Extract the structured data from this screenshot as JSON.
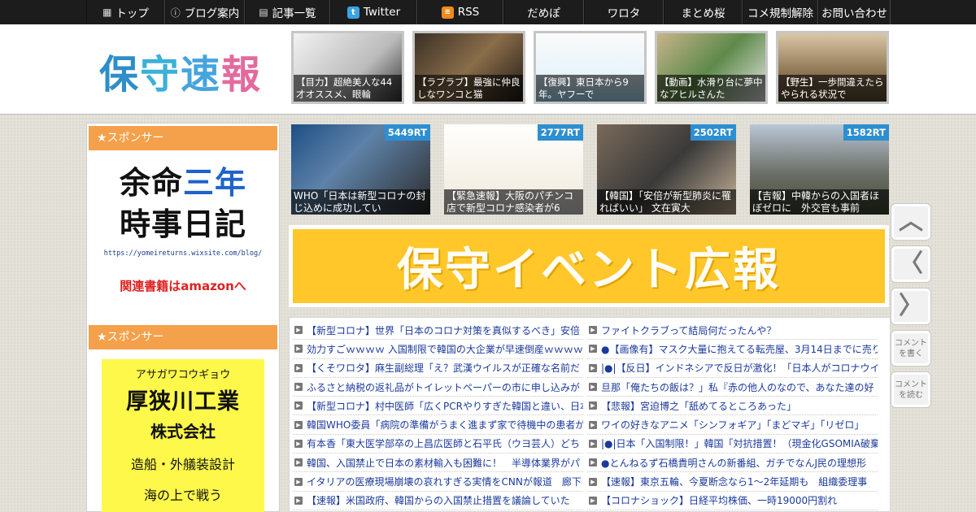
{
  "nav": {
    "items": [
      {
        "label": "トップ",
        "icon": "home-icon",
        "glyph": "▦",
        "width": 97
      },
      {
        "label": "ブログ案内",
        "icon": "info-icon",
        "glyph": "ⓘ",
        "width": 98
      },
      {
        "label": "記事一覧",
        "icon": "list-icon",
        "glyph": "▤",
        "width": 105
      },
      {
        "label": "Twitter",
        "icon": "twitter-icon",
        "glyph": "t",
        "width": 107
      },
      {
        "label": "RSS",
        "icon": "rss-icon",
        "glyph": "≋",
        "width": 106
      },
      {
        "label": "だめぽ",
        "icon": "",
        "glyph": "",
        "width": 99
      },
      {
        "label": "ワロタ",
        "icon": "",
        "glyph": "",
        "width": 98
      },
      {
        "label": "まとめ桜",
        "icon": "",
        "glyph": "",
        "width": 97
      },
      {
        "label": "コメ規制解除",
        "icon": "",
        "glyph": "",
        "width": 93
      },
      {
        "label": "お問い合わせ",
        "icon": "",
        "glyph": "",
        "width": 89
      }
    ]
  },
  "logo": {
    "chars": [
      "保",
      "守",
      "速",
      "報"
    ]
  },
  "header_thumbs": [
    {
      "caption": "【目力】超絶美人な44才オススメ、眼輪",
      "bg": "linear-gradient(135deg,#f2f2f2,#bbb 60%,#333)"
    },
    {
      "caption": "【ラブラブ】最強に仲良しなワンコと猫",
      "bg": "linear-gradient(135deg,#3a3026,#8a6d4a 50%,#1e1a14)"
    },
    {
      "caption": "【復興】東日本から9年。ヤフーで",
      "bg": "linear-gradient(180deg,#fafafa,#e8f4fb 60%,#9dd6ee)"
    },
    {
      "caption": "【動画】水滑り台に夢中なアヒルさんた",
      "bg": "linear-gradient(135deg,#c7b48a,#5e8a4a 50%,#e5e5e5)"
    },
    {
      "caption": "【野生】一歩間違えたらやられる状況で",
      "bg": "linear-gradient(180deg,#d9c7a5,#8a7150 60%,#5a4a30)"
    }
  ],
  "sidebar": {
    "sponsor1_title": "★スポンサー",
    "ad1": {
      "line1a": "余命",
      "line1b": "三年",
      "line2": "時事日記",
      "url": "https://yomeireturns.wixsite.com/blog/",
      "amazon": "関連書籍はamazonへ"
    },
    "sponsor2_title": "★スポンサー",
    "ad2": {
      "kana": "アサガワコウギョウ",
      "name": "厚狭川工業",
      "corp": "株式会社",
      "business": "造船・外艤装設計",
      "more": "海の上で戦う"
    }
  },
  "hot_articles": [
    {
      "rt": "5449RT",
      "caption": "WHO「日本は新型コロナの封じ込めに成功してい",
      "bg": "linear-gradient(135deg,#1d4f86,#5e82a8 40%,#2b2b2b)"
    },
    {
      "rt": "2777RT",
      "caption": "【緊急速報】大阪のパチンコ店で新型コロナ感染者が6",
      "bg": "linear-gradient(180deg,#fff,#f4efe4 70%,#ddd)"
    },
    {
      "rt": "2502RT",
      "caption": "【韓国】「安倍が新型肺炎に罹ればいい」 文在寅大",
      "bg": "linear-gradient(135deg,#7a6a5a,#3a3a3a 50%,#c9b49a)"
    },
    {
      "rt": "1582RT",
      "caption": "【吉報】中韓からの入国者ほぼゼロに　外交官も事前",
      "bg": "linear-gradient(180deg,#b9c7d6,#6c6e66 55%,#3d4a33)"
    }
  ],
  "banner": {
    "text": "保守イベント広報"
  },
  "list_left": [
    "【新型コロナ】世界「日本のコロナ対策を真似するべき」安倍",
    "効力すごｗｗｗｗ 入国制限で韓国の大企業が早速倒産ｗｗｗｗ",
    "【くそワロタ】麻生副総理「え？武漢ウイルスが正確な名前だ",
    "ふるさと納税の返礼品がトイレットペーパーの市に申し込みが",
    "【新型コロナ】村中医師「広くPCRやりすぎた韓国と違い、日本",
    "韓国WHO委員「病院の準備がうまく進まず家で待機中の患者が",
    "有本香「東大医学部卒の上昌広医師と石平氏（ウヨ芸人）どち",
    "韓国、入国禁止で日本の素材輸入も困難に！　半導体業界がパ",
    "イタリアの医療現場崩壊の哀れすぎる実情をCNNが報道　廊下",
    "【速報】米国政府、韓国からの入国禁止措置を議論していた"
  ],
  "list_right": [
    "ファイトクラブって結局何だったんや？",
    "●【画像有】マスク大量に抱えてる転売屋、3月14日までに売り",
    "|●|【反日】インドネシアで反日が激化！「日本人がコロナウイ",
    "旦那「俺たちの飯は？」私『赤の他人のなので、あなた達の好",
    "【悲報】宮迫博之「舐めてるところあった」",
    "ワイの好きなアニメ「シンフォギア」「まどマギ」「リゼロ」",
    "|●|日本「入国制限！」韓国「対抗措置！（現金化GSOMIA破棄",
    "●とんねるず石橋貴明さんの新番組、ガチでなんJ民の理想形",
    "【速報】東京五輪、今夏断念なら1～2年延期も　組織委理事",
    "【コロナショック】日経平均株価、一時19000円割れ"
  ],
  "side_buttons": {
    "top": "︿",
    "prev": "〈",
    "next": "〉",
    "write": "コメントを書く",
    "read": "コメントを読む"
  }
}
